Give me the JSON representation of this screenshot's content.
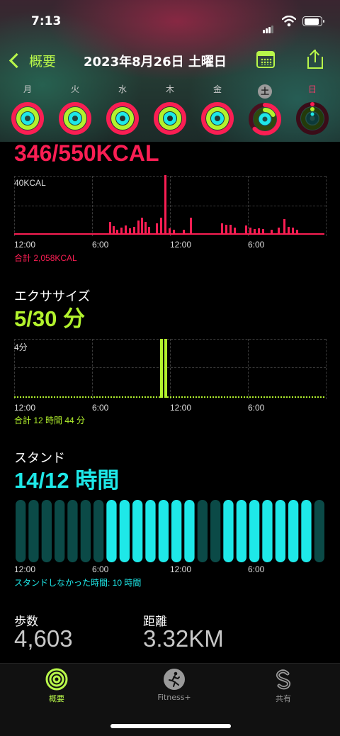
{
  "status_bar": {
    "time": "7:13"
  },
  "nav": {
    "back_label": "概要",
    "title": "2023年8月26日 土曜日"
  },
  "week": {
    "days": [
      {
        "label": "月"
      },
      {
        "label": "火"
      },
      {
        "label": "水"
      },
      {
        "label": "木"
      },
      {
        "label": "金"
      },
      {
        "label": "土"
      },
      {
        "label": "日"
      }
    ]
  },
  "colors": {
    "move": "#fa1e53",
    "exercise": "#b2f22d",
    "stand": "#1ee8e8",
    "accent": "#b8f74a"
  },
  "move": {
    "value": "346/550KCAL",
    "axis_max": "40KCAL",
    "total": "合計 2,058KCAL",
    "x_labels": [
      "12:00",
      "6:00",
      "12:00",
      "6:00"
    ]
  },
  "exercise": {
    "title": "エクササイズ",
    "value": "5/30 分",
    "axis_max": "4分",
    "total": "合計 12 時間 44 分",
    "x_labels": [
      "12:00",
      "6:00",
      "12:00",
      "6:00"
    ]
  },
  "stand": {
    "title": "スタンド",
    "value": "14/12 時間",
    "summary": "スタンドしなかった時間: 10 時間",
    "x_labels": [
      "12:00",
      "6:00",
      "12:00",
      "6:00"
    ]
  },
  "steps": {
    "label": "歩数",
    "value": "4,603"
  },
  "distance": {
    "label": "距離",
    "value": "3.32KM"
  },
  "tabs": [
    {
      "label": "概要",
      "icon": "activity-rings-icon",
      "active": true
    },
    {
      "label": "Fitness+",
      "icon": "running-figure-icon",
      "active": false
    },
    {
      "label": "共有",
      "icon": "sharing-s-icon",
      "active": false
    }
  ]
}
